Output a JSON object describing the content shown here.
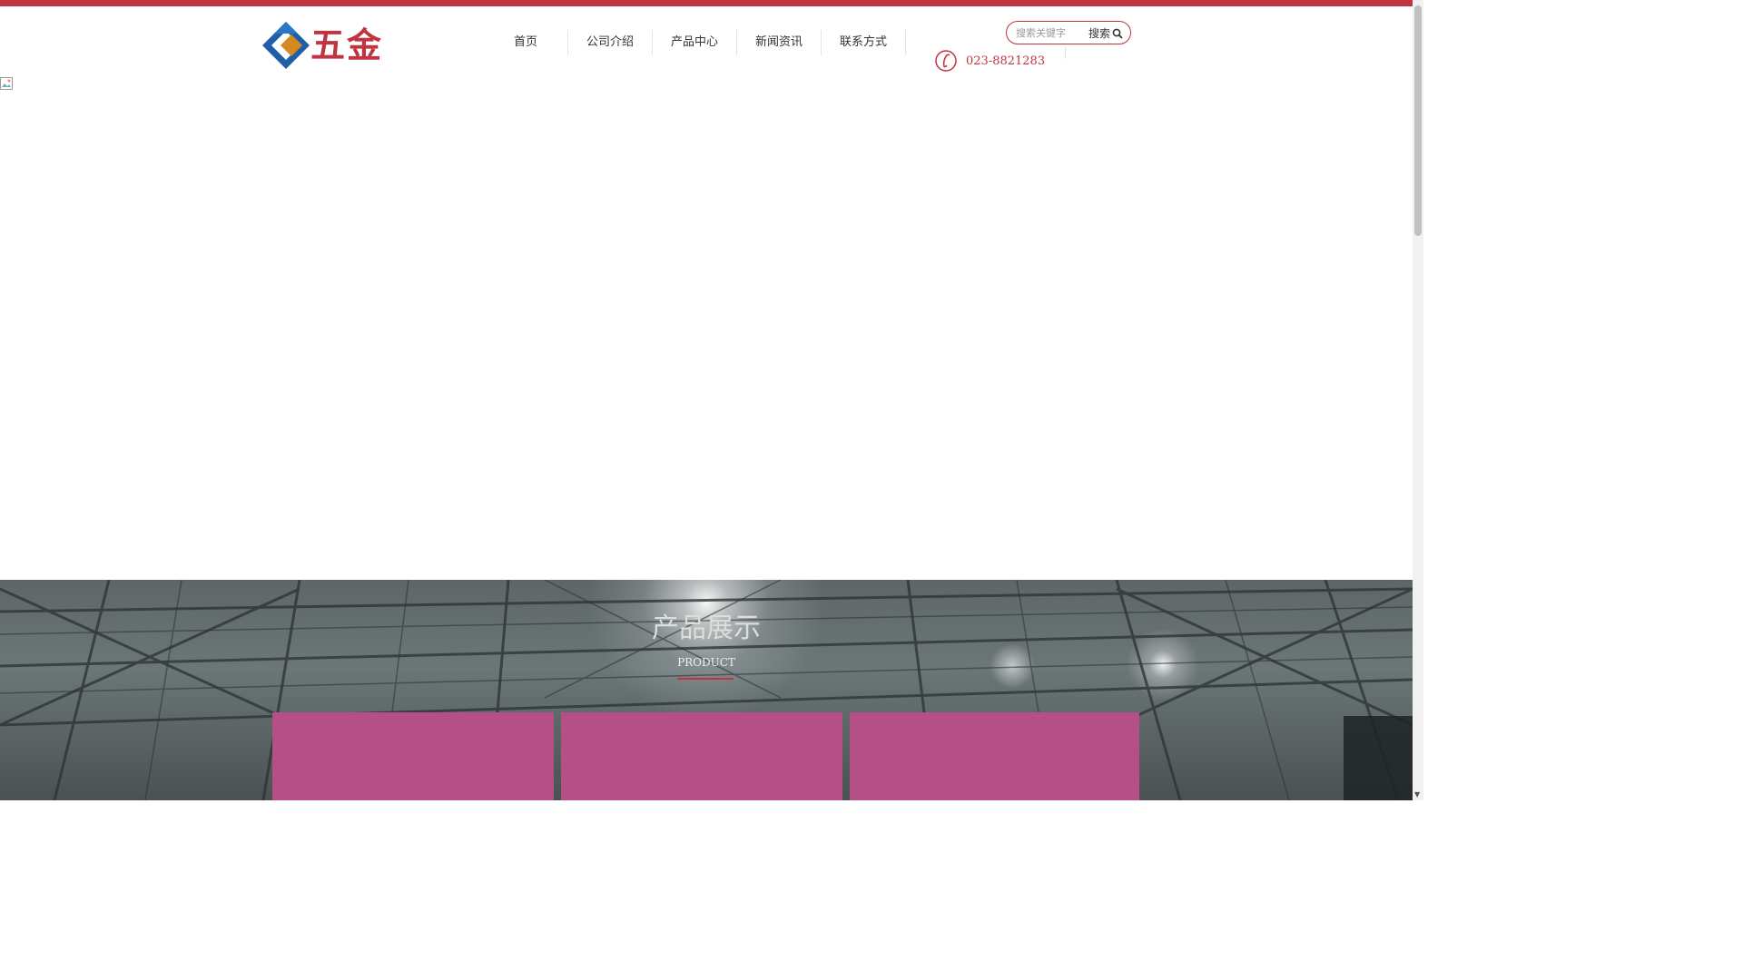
{
  "header": {
    "logo_text": "五金",
    "nav": [
      "首页",
      "公司介绍",
      "产品中心",
      "新闻资讯",
      "联系方式"
    ],
    "search": {
      "placeholder": "搜索关键字",
      "button_label": "搜索"
    },
    "phone": "023-8821283"
  },
  "banner": {
    "slides_total": 3,
    "active_slide": 1
  },
  "product_section": {
    "title": "产品展示",
    "subtitle": "PRODUCT"
  },
  "colors": {
    "brand": "#c0343f",
    "card": "#b54f88"
  }
}
